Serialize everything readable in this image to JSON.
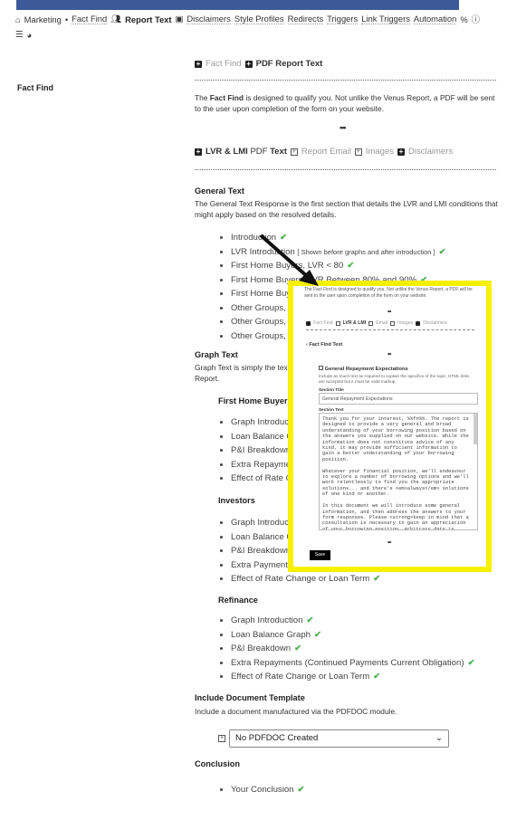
{
  "nav": {
    "home": "Marketing",
    "items": [
      "Fact Find",
      "Report Text",
      "Disclaimers",
      "Style Profiles",
      "Redirects",
      "Triggers",
      "Link Triggers",
      "Automation"
    ]
  },
  "sidebar": {
    "title": "Fact Find"
  },
  "tabs1": [
    "Fact Find",
    "PDF Report Text"
  ],
  "intro": {
    "pre": "The ",
    "bold": "Fact Find",
    "post": " is designed to qualify you. Not unlike the Venus Report, a PDF will be sent to the user upon completion of the form on your website."
  },
  "ellipsis": "•••",
  "tabs2": {
    "a": "LVR & LMI",
    "b": "PDF",
    "c": "Text",
    "d": "Report Email",
    "e": "Images",
    "f": "Disclaimers"
  },
  "general": {
    "title": "General Text",
    "desc": "The General Text Response is the first section that details the LVR and LMI conditions that might apply based on the resolved details.",
    "items": [
      "Introduction",
      "LVR Introduction",
      "First Home Buyers, LVR < 80",
      "First Home Buyers, LVR Between 80% and 90%",
      "First Home Buye",
      "Other Groups, L",
      "Other Groups, L",
      "Other Groups, L"
    ],
    "note": "[ Shown before graphs and after introduction ]"
  },
  "graph": {
    "title": "Graph Text",
    "desc": "Graph Text is simply the text",
    "desc2": "Report."
  },
  "groups": [
    {
      "title": "First Home Buyers",
      "items": [
        "Graph Introduct",
        "Loan Balance G",
        "P&I Breakdown",
        "Extra Repaymer",
        "Effect of Rate C"
      ]
    },
    {
      "title": "Investors",
      "items": [
        "Graph Introduct",
        "Loan Balance G",
        "P&I Breakdown",
        "Extra Payments",
        "Effect of Rate Change or Loan Term"
      ]
    },
    {
      "title": "Refinance",
      "items": [
        "Graph Introduction",
        "Loan Balance Graph",
        "P&I Breakdown",
        "Extra Repayments (Continued Payments Current Obligation)",
        "Effect of Rate Change or Loan Term"
      ]
    }
  ],
  "template": {
    "title": "Include Document Template",
    "desc": "Include a document manufactured via the PDFDOC module.",
    "select": "No PDFDOC Created"
  },
  "conclusion": {
    "title": "Conclusion",
    "items": [
      "Your Conclusion"
    ]
  },
  "overlay": {
    "intro": "The Fact Find is designed to qualify you. Not unlike the Venus Report, a PDF will be sent to the user upon completion of the form on your website.",
    "tabs": [
      "Fact Find",
      "LVR & LMI",
      "Email",
      "Images",
      "Disclaimers"
    ],
    "back": "Fact Find Text",
    "heading": "General Repayment Expectations",
    "desc": "Include as much text as required to explain the specifics of the topic. HTML links are accepted but it must be valid markup.",
    "title_label": "Section Title",
    "title_value": "General Repayment Expectations",
    "text_label": "Section Text",
    "text_value": "Thank you for your interest, %%fn%%. The report is designed to provide a very general and broad understanding of your borrowing position based on the answers you supplied on our website. While the information does not constitute advice of any kind, it may provide sufficient information to gain a better understanding of your borrowing position.\n\nWhatever your financial position, we'll endeavour to explore a number of borrowing options and we'll work relentlessly to find you the appropriate solutions... and there's <em>always</em> solutions of one kind or another.\n\nIn this document we will introduce some general information, and then address the answers to your form responses. Please <strong>keep in mind that a consultation is necessary to gain an appreciation of your borrowing position. Arbitrary data is often used, and the report cannot be considered as anything that resembles advice</strong>.\n\n[title]Interest Rates[/title]\n\nIt is important to understand that a lower interest rate is not always the best interest rate. A Comparison Rate is a",
    "save": "Save"
  },
  "colors": {
    "topbar": "#3d5a98",
    "highlight": "#f7f000",
    "check": "#4caf50"
  }
}
